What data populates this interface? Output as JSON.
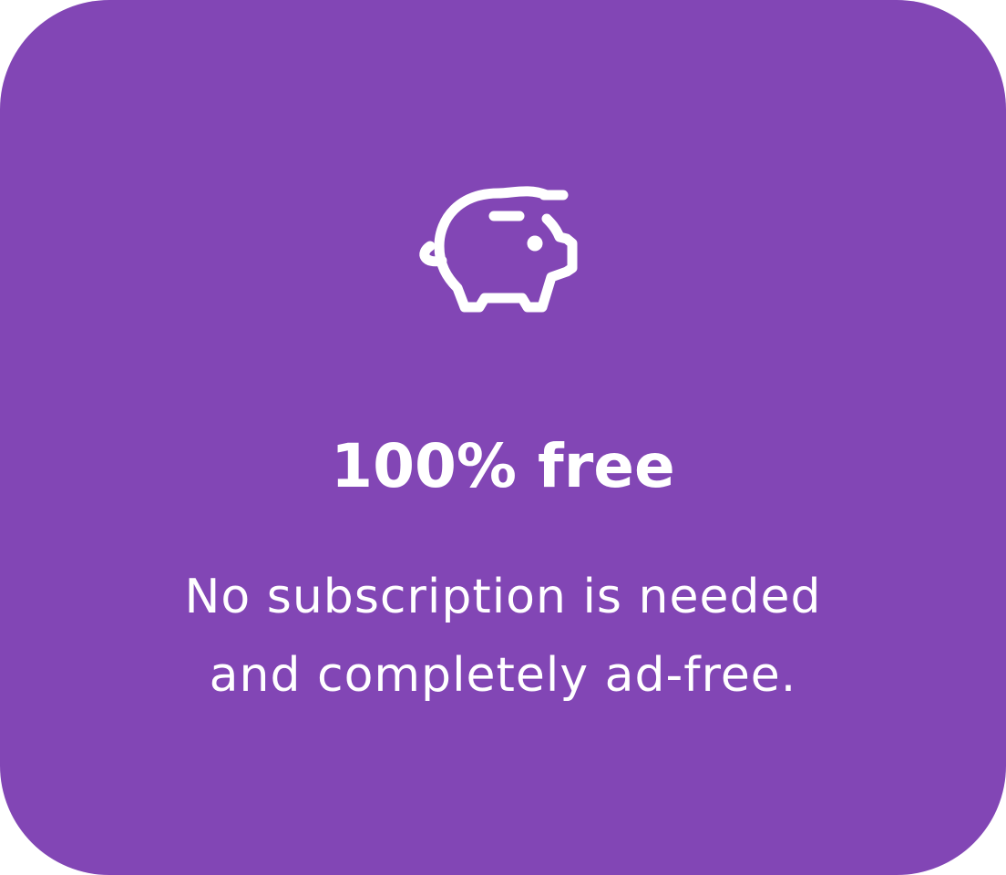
{
  "card": {
    "background_color": "#8246b5",
    "text_color": "#ffffff",
    "icon": "piggy-bank-icon",
    "title": "100% free",
    "description_lines": [
      "No subscription is needed",
      "and completely ad-free."
    ]
  }
}
